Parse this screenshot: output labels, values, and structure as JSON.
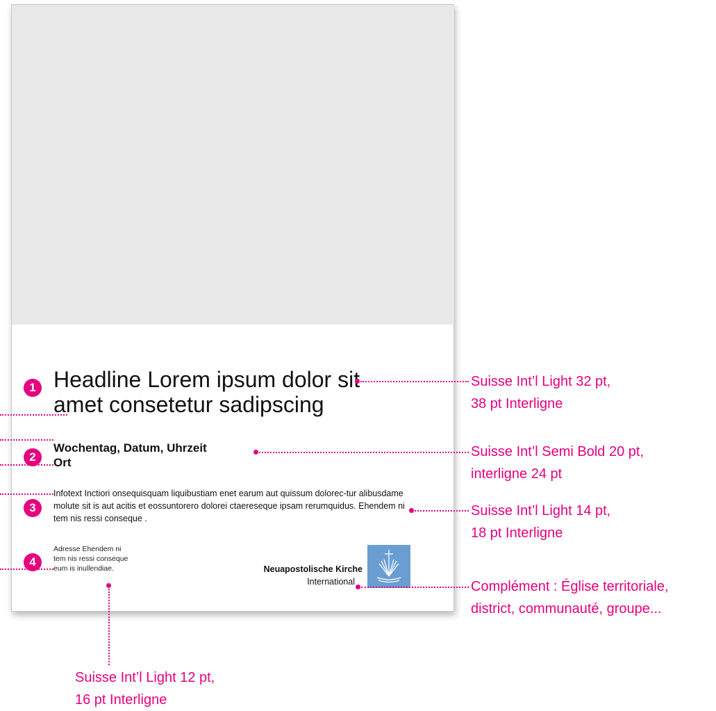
{
  "layout_sample": {
    "headline": "Headline Lorem ipsum dolor sit amet consetetur sadipscing",
    "event_line1": "Wochentag, Datum, Uhrzeit",
    "event_line2": "Ort",
    "infotext": "Infotext Inctiori onsequisquam liquibustiam enet earum aut quissum dolorec-tur alibusdame molute sit is aut acitis et eossuntorero dolorei ctaereseque ipsam rerumquidus. Ehendem ni tem nis ressi conseque .",
    "address": "Adresse Ehendem ni tem nis ressi conseque eum is inullendiae.",
    "organization": "Neuapostolische Kirche",
    "organization_sub": "International"
  },
  "badges": [
    "1",
    "2",
    "3",
    "4"
  ],
  "annotations": {
    "headline_line1": "Suisse Int’l Light 32 pt,",
    "headline_line2": "38 pt Interligne",
    "event_line1": "Suisse Int’l Semi Bold 20 pt,",
    "event_line2": "interligne 24 pt",
    "infotext_line1": "Suisse Int’l Light 14 pt,",
    "infotext_line2": "18 pt Interligne",
    "complement_line1": "Complément : Église territoriale,",
    "complement_line2": "district, communauté, groupe...",
    "address_line1": "Suisse Int’l Light 12 pt,",
    "address_line2": "16 pt Interligne"
  },
  "colors": {
    "accent": "#e6007e",
    "placeholder_gray": "#e8e8e8",
    "logo_blue": "#6a9ed3"
  },
  "logo_icon": "church-cross-logo-icon"
}
